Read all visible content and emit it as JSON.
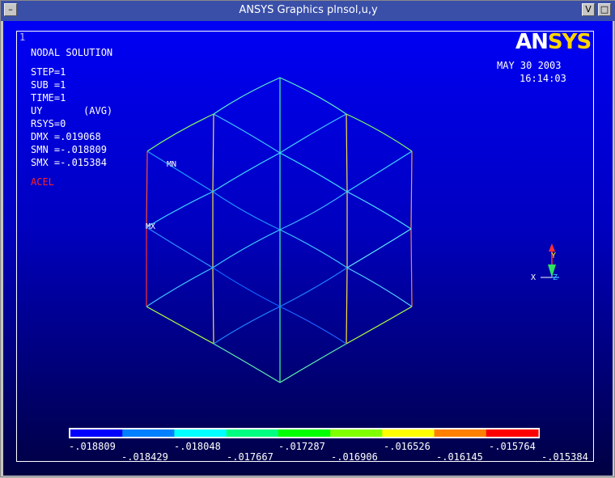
{
  "window": {
    "title": "ANSYS Graphics    plnsol,u,y",
    "menu_glyph": "–",
    "minimize_glyph": "V",
    "maximize_glyph": "□"
  },
  "plot": {
    "window_number": "1",
    "heading": "NODAL SOLUTION",
    "info_lines": [
      "STEP=1",
      "SUB =1",
      "TIME=1",
      "UY       (AVG)",
      "RSYS=0",
      "DMX =.019068",
      "SMN =-.018809",
      "SMX =-.015384"
    ],
    "acel_label": "ACEL",
    "date": "MAY 30 2003",
    "time": "16:14:03",
    "logo_an": "AN",
    "logo_sys": "SYS",
    "mn_label": "MN",
    "mx_label": "MX"
  },
  "triad": {
    "x_label": "X",
    "y_label": "Y",
    "z_label": "Z"
  },
  "legend": {
    "colors": [
      "#0000ff",
      "#0080ff",
      "#00ffff",
      "#00ff80",
      "#00ff00",
      "#80ff00",
      "#ffff00",
      "#ff8000",
      "#ff0000"
    ],
    "top_labels": [
      "-.018809",
      "-.018048",
      "-.017287",
      "-.016526",
      "-.015764"
    ],
    "bottom_labels": [
      "-.018429",
      "-.017667",
      "-.016906",
      "-.016145",
      "-.015384"
    ]
  },
  "colors": {
    "background_top": "#0000ff",
    "background_bottom": "#00003a",
    "frame": "#ffffff"
  }
}
